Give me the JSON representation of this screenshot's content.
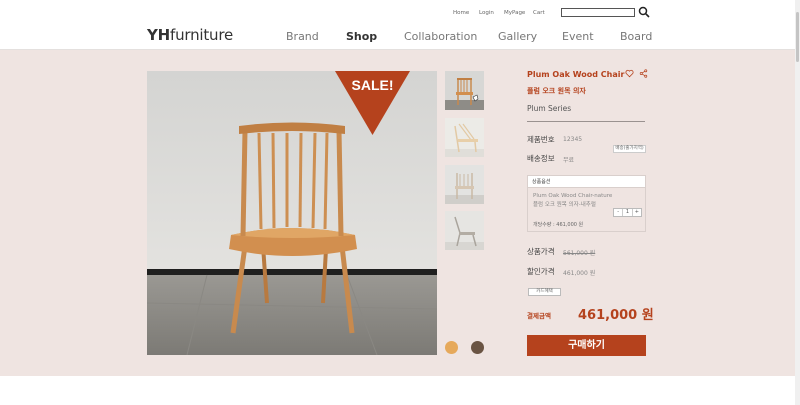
{
  "util_links": [
    "Home",
    "Login",
    "MyPage",
    "Cart"
  ],
  "search": {
    "placeholder": ""
  },
  "logo": {
    "bold": "YH",
    "rest": "furniture"
  },
  "nav": [
    "Brand",
    "Shop",
    "Collaboration",
    "Gallery",
    "Event",
    "Board"
  ],
  "active_nav": "Shop",
  "sale_badge": "SALE!",
  "product": {
    "title": "Plum Oak Wood Chair",
    "title_kor": "플럼 오크 원목 의자",
    "series": "Plum Series",
    "code_label": "제품번호",
    "code_value": "12345",
    "ship_label": "배송정보",
    "ship_value": "무료",
    "ship_button": "배송(출가지역)",
    "option_header": "상품옵션",
    "option_line1": "Plum Oak Wood Chair-nature",
    "option_line2": "플럼 오크 원목 의자-내추럴",
    "stepper_minus": "-",
    "stepper_value": "1",
    "stepper_plus": "+",
    "option_qty": "개당수량 : 461,000 원",
    "price_label": "상품가격",
    "price_value": "561,000 원",
    "discount_label": "할인가격",
    "discount_value": "461,000 원",
    "card_badge": "카드혜택",
    "pay_label": "결제금액",
    "pay_value": "461,000 원",
    "buy_button": "구매하기"
  },
  "colors": {
    "accent": "#b5421d",
    "band": "#efe4e1",
    "dot1": "#e6a95b",
    "dot2": "#6a5443"
  }
}
